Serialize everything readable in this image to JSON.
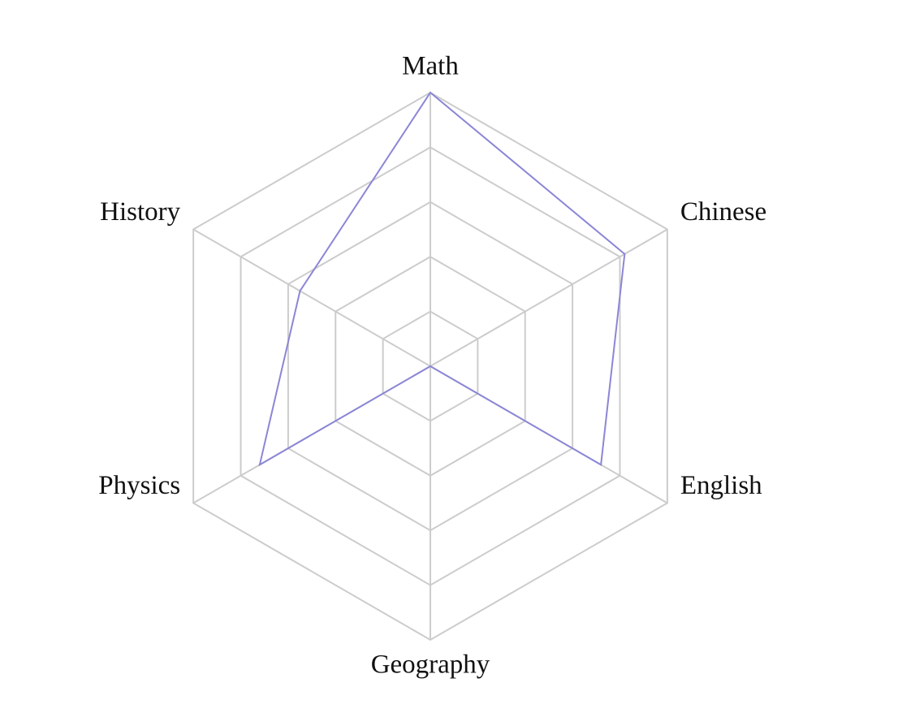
{
  "chart_data": {
    "type": "radar",
    "categories": [
      "Math",
      "Chinese",
      "English",
      "Geography",
      "Physics",
      "History"
    ],
    "series": [
      {
        "values": [
          100,
          82,
          72,
          0,
          72,
          55
        ]
      }
    ],
    "rlim": [
      0,
      100
    ],
    "grid_levels": 5,
    "legend": "none",
    "colors": {
      "series": "#8b86d6",
      "grid": "#cccccc",
      "text": "#111111"
    }
  }
}
